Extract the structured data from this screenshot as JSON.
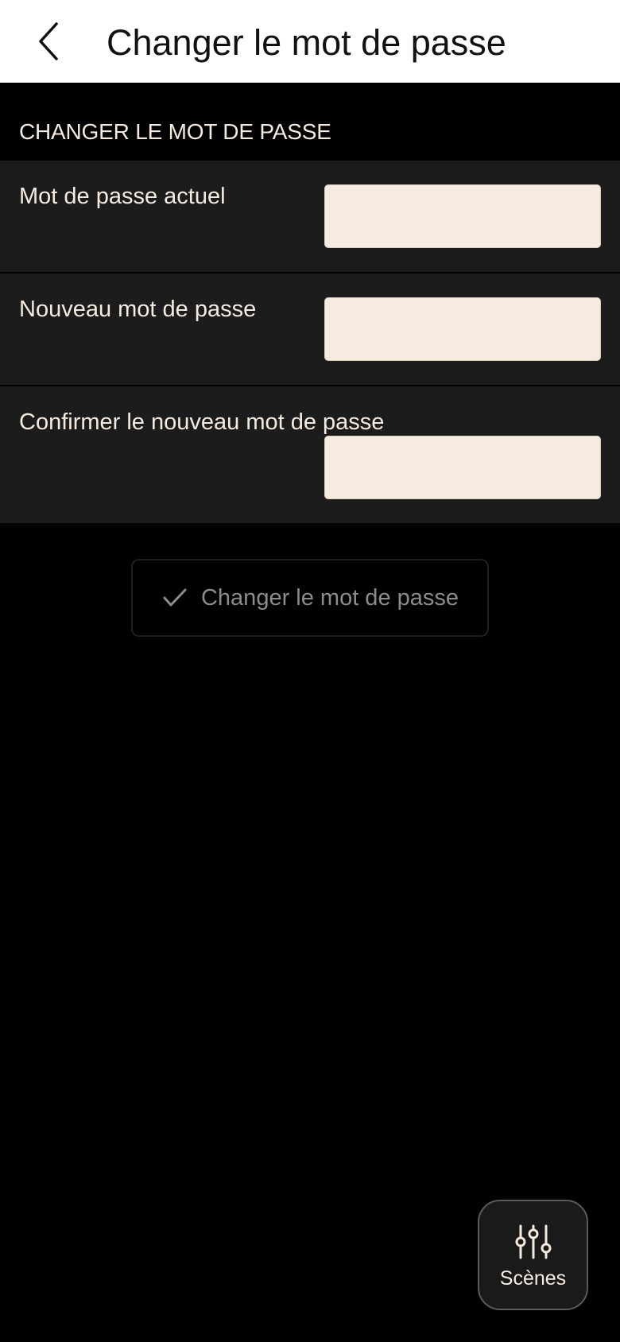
{
  "header": {
    "title": "Changer le mot de passe",
    "back_icon": "chevron-left-icon"
  },
  "section": {
    "title": "CHANGER LE MOT DE PASSE"
  },
  "fields": [
    {
      "label": "Mot de passe actuel",
      "value": ""
    },
    {
      "label": "Nouveau mot de passe",
      "value": ""
    },
    {
      "label": "Confirmer le nouveau mot de passe",
      "value": ""
    }
  ],
  "submit": {
    "label": "Changer le mot de passe",
    "icon": "check-icon"
  },
  "fab": {
    "label": "Scènes",
    "icon": "sliders-icon"
  },
  "colors": {
    "background": "#000000",
    "header_background": "#ffffff",
    "row_background": "#1c1c1c",
    "input_background": "#f6ebdf",
    "text_light": "#f5ebe0",
    "text_muted": "#8c8c8c"
  }
}
